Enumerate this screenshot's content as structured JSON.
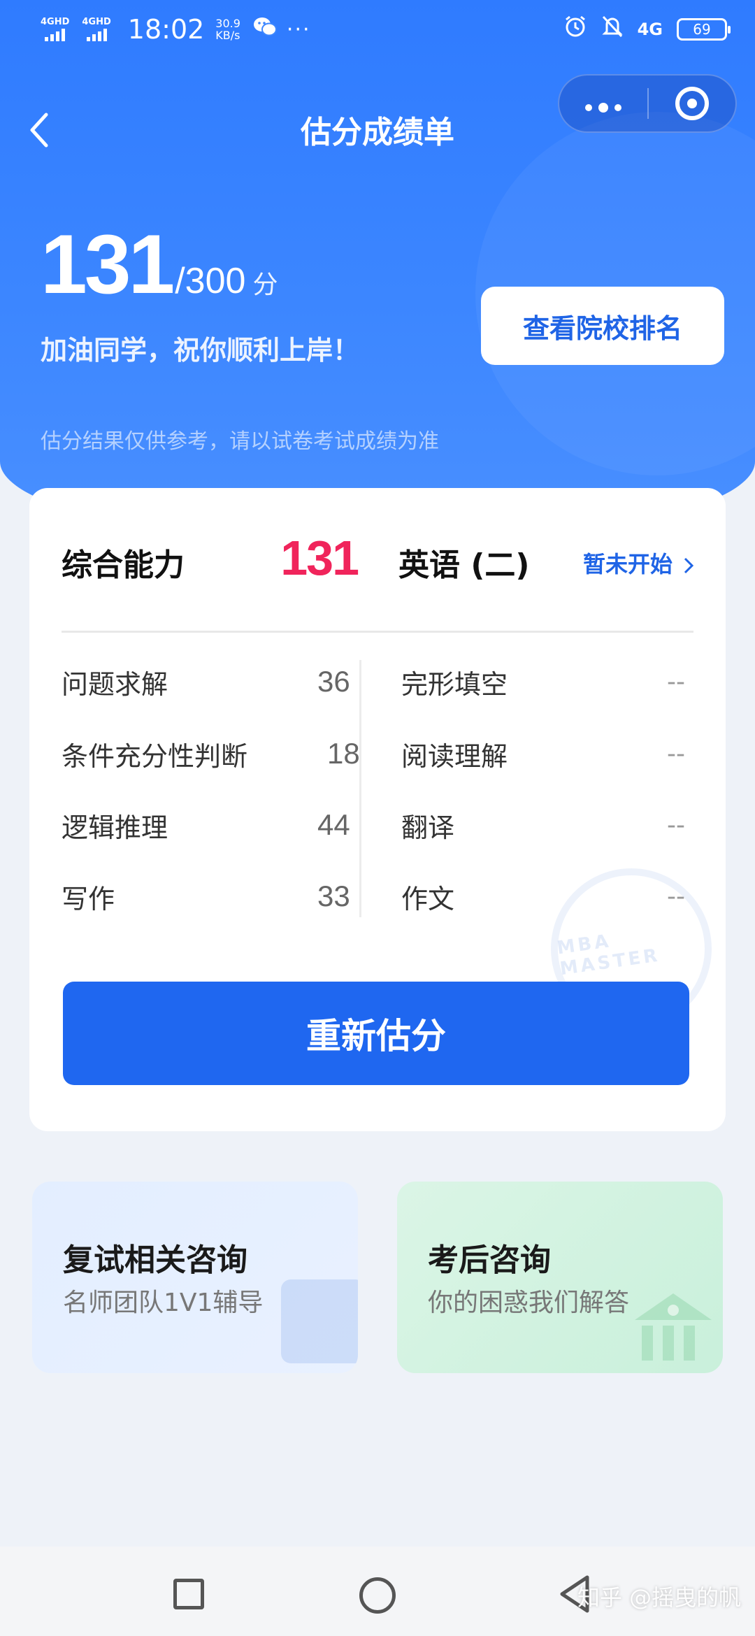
{
  "status_bar": {
    "signal1": "4GHD",
    "signal2": "4GHD",
    "time": "18:02",
    "speed_value": "30.9",
    "speed_unit": "KB/s",
    "network": "4G",
    "battery": "69"
  },
  "nav": {
    "title": "估分成绩单"
  },
  "summary": {
    "score": "131",
    "total": "/300",
    "unit": "分",
    "cheer": "加油同学，祝你顺利上岸！",
    "disclaimer": "估分结果仅供参考，请以试卷考试成绩为准",
    "rank_button": "查看院校排名"
  },
  "card": {
    "left_title": "综合能力",
    "left_score": "131",
    "right_title": "英语 (二)",
    "right_link": "暂未开始",
    "left_items": [
      {
        "label": "问题求解",
        "value": "36"
      },
      {
        "label": "条件充分性判断",
        "value": "18"
      },
      {
        "label": "逻辑推理",
        "value": "44"
      },
      {
        "label": "写作",
        "value": "33"
      }
    ],
    "right_items": [
      {
        "label": "完形填空",
        "value": "--"
      },
      {
        "label": "阅读理解",
        "value": "--"
      },
      {
        "label": "翻译",
        "value": "--"
      },
      {
        "label": "作文",
        "value": "--"
      }
    ],
    "stamp_text": "MBA MASTER",
    "reestimate_button": "重新估分"
  },
  "promos": [
    {
      "title": "复试相关咨询",
      "subtitle": "名师团队1V1辅导"
    },
    {
      "title": "考后咨询",
      "subtitle": "你的困惑我们解答"
    }
  ],
  "watermark": "知乎 @摇曳的帆",
  "colors": {
    "primary": "#1f67f0",
    "score_red": "#f0245b",
    "header_blue": "#3c86ff"
  }
}
